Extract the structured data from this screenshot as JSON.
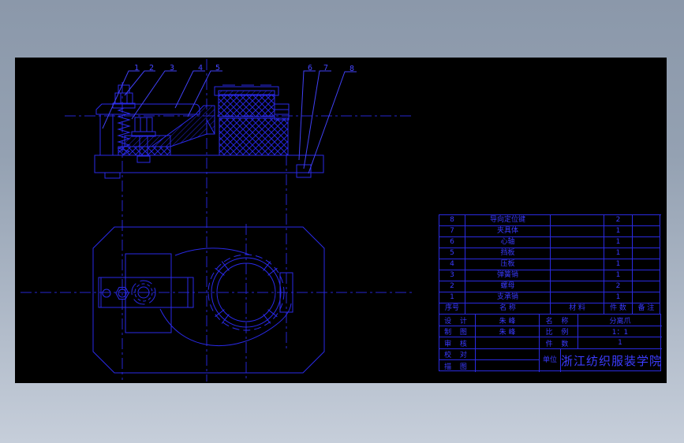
{
  "colors": {
    "line_blue": "#2a2ae0",
    "bright_blue": "#4545ff",
    "canvas_bg": "#000000",
    "frame_top_gray": "#8b98aa",
    "frame_bottom_gray": "#c6ceda"
  },
  "drawing": {
    "callouts": [
      "1",
      "2",
      "3",
      "4",
      "5",
      "6",
      "7",
      "8"
    ]
  },
  "parts_table": {
    "rows": [
      {
        "no": "8",
        "name": "导向定位键",
        "material": "",
        "qty": "2",
        "remark": ""
      },
      {
        "no": "7",
        "name": "夹具体",
        "material": "",
        "qty": "1",
        "remark": ""
      },
      {
        "no": "6",
        "name": "心轴",
        "material": "",
        "qty": "1",
        "remark": ""
      },
      {
        "no": "5",
        "name": "挡板",
        "material": "",
        "qty": "1",
        "remark": ""
      },
      {
        "no": "4",
        "name": "压板",
        "material": "",
        "qty": "1",
        "remark": ""
      },
      {
        "no": "3",
        "name": "弹簧销",
        "material": "",
        "qty": "1",
        "remark": ""
      },
      {
        "no": "2",
        "name": "螺母",
        "material": "",
        "qty": "2",
        "remark": ""
      },
      {
        "no": "1",
        "name": "支承销",
        "material": "",
        "qty": "1",
        "remark": ""
      }
    ],
    "header": {
      "no": "序号",
      "name": "名        称",
      "material": "材  料",
      "qty": "件  数",
      "remark": "备  注"
    }
  },
  "title_block": {
    "design_label": "设 计",
    "design_value": "朱  峰",
    "name_label": "名 称",
    "name_value": "分离爪",
    "draft_label": "制 图",
    "draft_value": "朱  峰",
    "scale_label": "比 例",
    "scale_value": "1：1",
    "check_label": "审 核",
    "check_value": "",
    "qty_label": "件 数",
    "qty_value": "1",
    "proof_label": "校 对",
    "proof_value": "",
    "trace_label": "描 图",
    "trace_value": "",
    "unit_label": "单位",
    "unit_value": "浙江纺织服装学院"
  }
}
